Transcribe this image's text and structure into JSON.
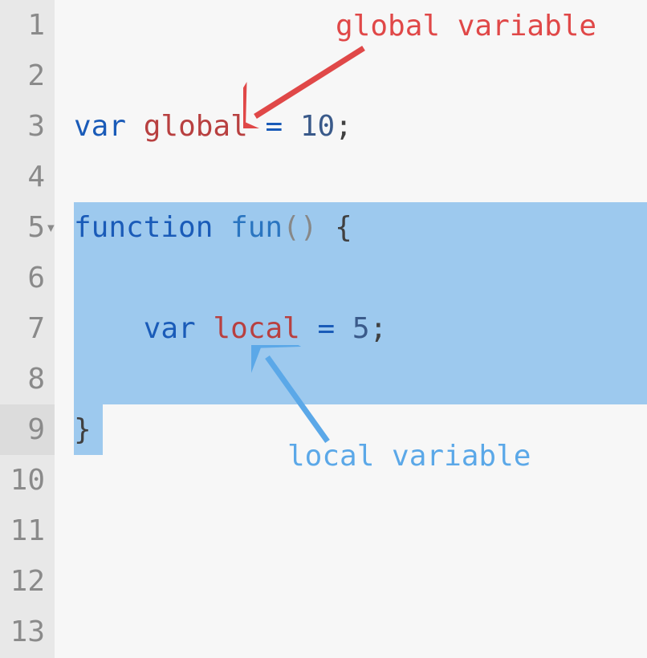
{
  "gutter": {
    "numbers": [
      "1",
      "2",
      "3",
      "4",
      "5",
      "6",
      "7",
      "8",
      "9",
      "10",
      "11",
      "12",
      "13"
    ],
    "fold_marker": "▾",
    "fold_line": 5,
    "active_line": 9
  },
  "code": {
    "line1": "",
    "line2": "",
    "line3": {
      "keyword": "var",
      "space1": " ",
      "ident": "global",
      "space2": " ",
      "op": "=",
      "space3": " ",
      "num": "10",
      "semi": ";"
    },
    "line4": "",
    "line5": {
      "keyword": "function",
      "space1": " ",
      "fname": "fun",
      "parens": "()",
      "space2": " ",
      "brace": "{"
    },
    "line6": "",
    "line7": {
      "indent": "    ",
      "keyword": "var",
      "space1": " ",
      "ident": "local",
      "space2": " ",
      "op": "=",
      "space3": " ",
      "num": "5",
      "semi": ";"
    },
    "line8": "",
    "line9": {
      "brace": "}"
    }
  },
  "annotations": {
    "global_label": "global variable",
    "local_label": "local variable"
  },
  "colors": {
    "red": "#e04848",
    "blue": "#5ba8e8",
    "highlight": "#9dc9ee"
  }
}
